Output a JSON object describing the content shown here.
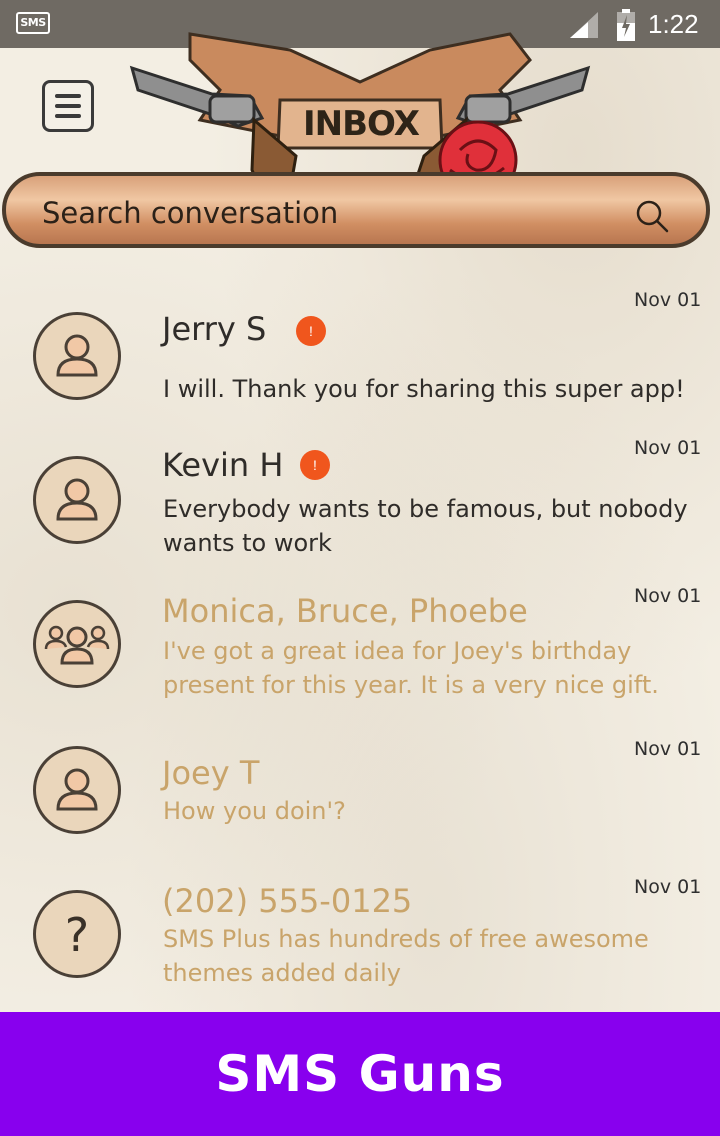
{
  "status_bar": {
    "app_icon_text": "SMS",
    "time": "1:22"
  },
  "header": {
    "title": "INBOX",
    "menu_icon": "hamburger-menu-icon"
  },
  "search": {
    "placeholder": "Search conversation",
    "icon": "search-icon"
  },
  "conversations": [
    {
      "name": "Jerry S",
      "date": "Nov 01",
      "snippet": "I will. Thank you for sharing this super app!",
      "unread": true,
      "badge": "!",
      "avatar": "person-icon"
    },
    {
      "name": "Kevin H",
      "date": "Nov 01",
      "snippet": "Everybody wants to be famous, but nobody wants to work",
      "unread": true,
      "badge": "!",
      "avatar": "person-icon"
    },
    {
      "name": "Monica, Bruce, Phoebe",
      "date": "Nov 01",
      "snippet": "I've got a great idea for Joey's birthday present for this year. It is a very nice gift.",
      "unread": false,
      "avatar": "group-icon"
    },
    {
      "name": "Joey T",
      "date": "Nov 01",
      "snippet": "How you doin'?",
      "unread": false,
      "avatar": "person-icon"
    },
    {
      "name": "(202) 555-0125",
      "date": "Nov 01",
      "snippet": "SMS Plus has hundreds of free awesome themes added daily",
      "unread": false,
      "avatar": "unknown-contact-icon"
    }
  ],
  "footer": {
    "title": "SMS Guns"
  },
  "colors": {
    "unread_text": "#2f2c29",
    "read_text": "#c9a46a",
    "badge": "#f0561d",
    "footer_bg": "#8800ee",
    "status_bar": "#6f6a63"
  }
}
